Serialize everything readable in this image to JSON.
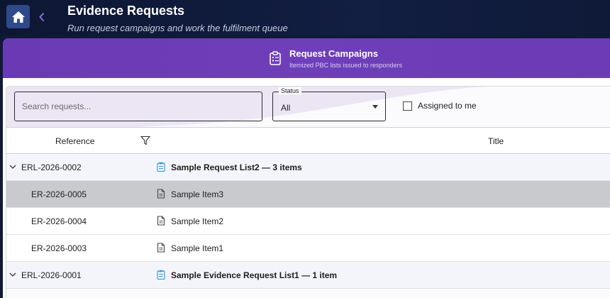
{
  "app": {
    "title": "Evidence Requests",
    "subtitle": "Run request campaigns and work the fulfilment queue"
  },
  "banner": {
    "title": "Request Campaigns",
    "subtitle": "Itemized PBC lists issued to responders"
  },
  "filters": {
    "search_placeholder": "Search requests...",
    "search_value": "",
    "status_label": "Status",
    "status_value": "All",
    "assigned_label": "Assigned to me",
    "assigned_checked": false
  },
  "grid": {
    "columns": [
      "Reference",
      "Title"
    ],
    "rows": [
      {
        "ref": "ERL-2026-0002",
        "title": "Sample Request List2 — 3 items",
        "type": "group",
        "icon": "clipboard-icon"
      },
      {
        "ref": "ER-2026-0005",
        "title": "Sample Item3",
        "type": "item",
        "icon": "document-icon",
        "selected": true
      },
      {
        "ref": "ER-2026-0004",
        "title": "Sample Item2",
        "type": "item",
        "icon": "document-icon"
      },
      {
        "ref": "ER-2026-0003",
        "title": "Sample Item1",
        "type": "item",
        "icon": "document-icon"
      },
      {
        "ref": "ERL-2026-0001",
        "title": "Sample Evidence Request List1 — 1 item",
        "type": "group",
        "icon": "clipboard-icon"
      }
    ]
  },
  "colors": {
    "appbar": "#0f1a38",
    "banner": "#6b3bb6",
    "accent_icon": "#3a9ad9",
    "selected_row": "#c9cacd"
  }
}
